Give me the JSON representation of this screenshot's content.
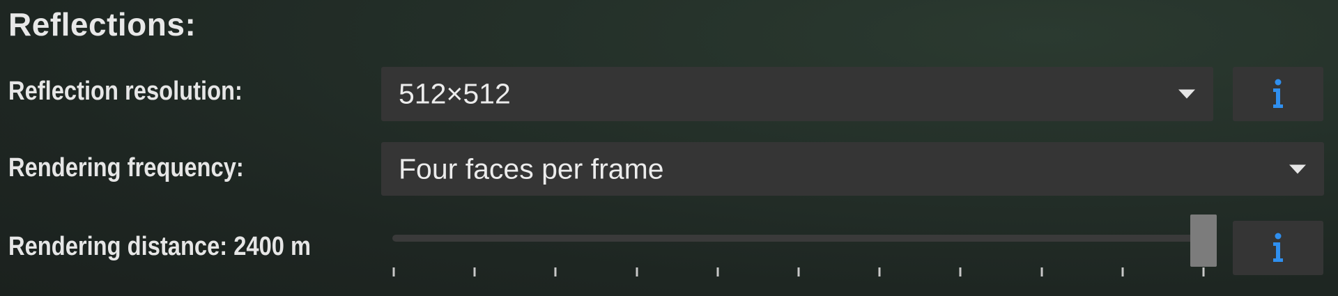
{
  "section": {
    "title": "Reflections:"
  },
  "reflection_resolution": {
    "label": "Reflection resolution:",
    "selected": "512×512"
  },
  "rendering_frequency": {
    "label": "Rendering frequency:",
    "selected": "Four faces per frame"
  },
  "rendering_distance": {
    "label": "Rendering distance: 2400 m",
    "slider_fraction": 1.0,
    "tick_count": 11
  },
  "icons": {
    "dropdown_arrow": "chevron-down-icon",
    "info": "info-icon"
  },
  "colors": {
    "info_icon": "#2f8fef",
    "control_bg": "#353535",
    "thumb": "#7c7c7c"
  }
}
